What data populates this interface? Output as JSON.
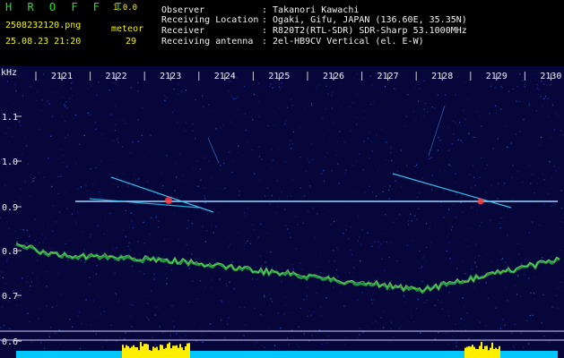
{
  "header": {
    "app_title": "H R O F F T",
    "app_version": "1.0.0",
    "file_name": "2508232120.png",
    "date_time": "25.08.23 21:20",
    "meteor_label": "meteor",
    "meteor_count": "29",
    "info_rows": [
      {
        "label": "Observer",
        "value": ": Takanori Kawachi"
      },
      {
        "label": "Receiving Location",
        "value": ": Ogaki, Gifu, JAPAN (136.60E, 35.35N)"
      },
      {
        "label": "Receiver",
        "value": ": R820T2(RTL-SDR) SDR-Sharp 53.1000MHz"
      },
      {
        "label": "Receiving antenna",
        "value": ": 2el-HB9CV Vertical (el. E-W)"
      }
    ]
  },
  "spectrogram": {
    "unit_label": "kHz",
    "time_ticks": [
      "2121",
      "2122",
      "2123",
      "2124",
      "2125",
      "2126",
      "2127",
      "2128",
      "2129",
      "2130"
    ],
    "freq_ticks": [
      "1.1",
      "1.0",
      "0.9",
      "0.8",
      "0.7",
      "0.6"
    ],
    "colors": {
      "background": "#06063a",
      "carrier": "#9fd4ff",
      "noise_band": "#1fa84a",
      "meteor_head": "#ff4040",
      "meteor_trail": "#39d0ff",
      "counter_bar": "#ffee00",
      "counter_base": "#00c8ff",
      "reference_line": "#cfcfff"
    }
  }
}
